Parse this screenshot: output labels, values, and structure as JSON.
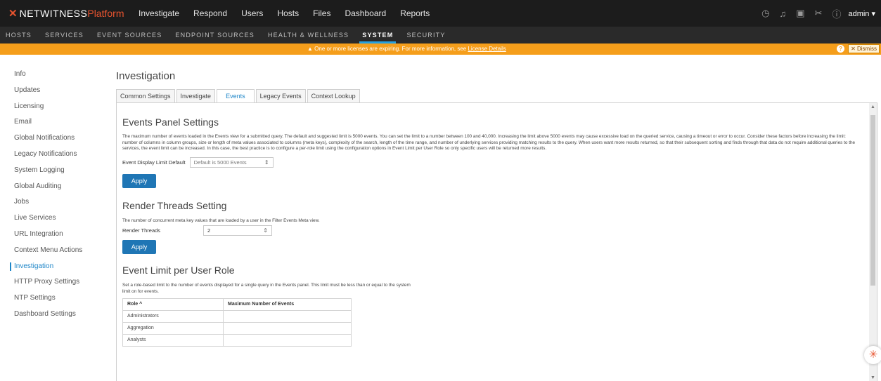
{
  "header": {
    "logo_mark": "✕",
    "logo_name": "NETWITNESS",
    "logo_platform": "Platform",
    "nav": [
      "Investigate",
      "Respond",
      "Users",
      "Hosts",
      "Files",
      "Dashboard",
      "Reports"
    ],
    "icons": [
      "timer-icon",
      "bell-icon",
      "tasks-icon",
      "tools-icon",
      "help-icon"
    ],
    "user": "admin"
  },
  "subnav": {
    "items": [
      "HOSTS",
      "SERVICES",
      "EVENT SOURCES",
      "ENDPOINT SOURCES",
      "HEALTH & WELLNESS",
      "SYSTEM",
      "SECURITY"
    ],
    "active": "SYSTEM"
  },
  "banner": {
    "message": "One or more licenses are expiring. For more information, see ",
    "link": "License Details",
    "dismiss": "Dismiss",
    "color": "#f59e1b"
  },
  "sidebar": {
    "items": [
      "Info",
      "Updates",
      "Licensing",
      "Email",
      "Global Notifications",
      "Legacy Notifications",
      "System Logging",
      "Global Auditing",
      "Jobs",
      "Live Services",
      "URL Integration",
      "Context Menu Actions",
      "Investigation",
      "HTTP Proxy Settings",
      "NTP Settings",
      "Dashboard Settings"
    ],
    "active": "Investigation"
  },
  "page": {
    "title": "Investigation",
    "tabs": [
      "Common Settings",
      "Investigate",
      "Events",
      "Legacy Events",
      "Context Lookup"
    ],
    "active_tab": "Events"
  },
  "events_panel": {
    "heading": "Events Panel Settings",
    "description": "The maximum number of events loaded in the Events view for a submitted query. The default and suggested limit is 5000 events. You can set the limit to a number between 100 and 40,000. Increasing the limit above 5000 events may cause excessive load on the queried service, causing a timeout or error to occur. Consider these factors before increasing the limit: number of columns in column groups, size or length of meta values associated to columns (meta keys), complexity of the search, length of the time range, and number of underlying services providing matching results to the query. When users want more results returned, so that their subsequent sorting and finds through that data do not require additional queries to the services, the event limit can be increased. In this case, the best practice is to configure a per-role limit using the configuration options in Event Limit per User Role so only specific users will be returned more results.",
    "field_label": "Event Display Limit Default",
    "field_value": "Default is 5000 Events",
    "apply": "Apply"
  },
  "render_threads": {
    "heading": "Render Threads Setting",
    "description": "The number of concurrent meta key values that are loaded by a user in the Filter Events Meta view.",
    "field_label": "Render Threads",
    "field_value": "2",
    "apply": "Apply"
  },
  "user_role": {
    "heading": "Event Limit per User Role",
    "description": "Set a role-based limit to the number of events displayed for a single query in the Events panel. This limit must be less than or equal to the system limit on for events.",
    "columns": [
      "Role ^",
      "Maximum Number of Events"
    ],
    "rows": [
      [
        "Administrators",
        ""
      ],
      [
        "Aggregation",
        ""
      ],
      [
        "Analysts",
        ""
      ]
    ]
  }
}
